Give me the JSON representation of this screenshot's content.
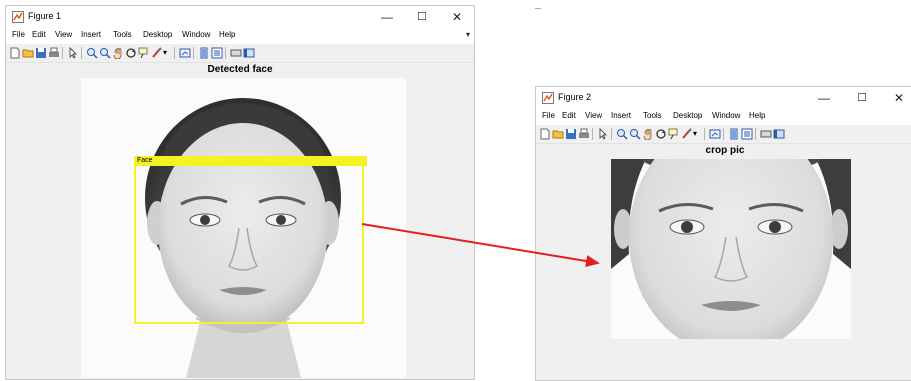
{
  "figure1": {
    "title": "Figure 1",
    "menu": [
      "File",
      "Edit",
      "View",
      "Insert",
      "Tools",
      "Desktop",
      "Window",
      "Help"
    ],
    "axes_title": "Detected face",
    "detection_label": "Face"
  },
  "figure2": {
    "title": "Figure 2",
    "menu": [
      "File",
      "Edit",
      "View",
      "Insert",
      "Tools",
      "Desktop",
      "Window",
      "Help"
    ],
    "axes_title": "crop pic"
  },
  "window_controls": {
    "minimize": "—",
    "maximize": "☐",
    "close": "✕"
  },
  "colors": {
    "detection_box": "#f2f226",
    "arrow": "#e02020"
  },
  "toolbar_icons": [
    "new-figure-icon",
    "open-file-icon",
    "save-icon",
    "print-icon",
    "pointer-icon",
    "zoom-in-icon",
    "zoom-out-icon",
    "pan-icon",
    "rotate-icon",
    "data-cursor-icon",
    "brush-icon",
    "link-plot-icon",
    "colorbar-icon",
    "legend-icon",
    "plot-tools-hide-icon",
    "plot-tools-show-icon"
  ]
}
